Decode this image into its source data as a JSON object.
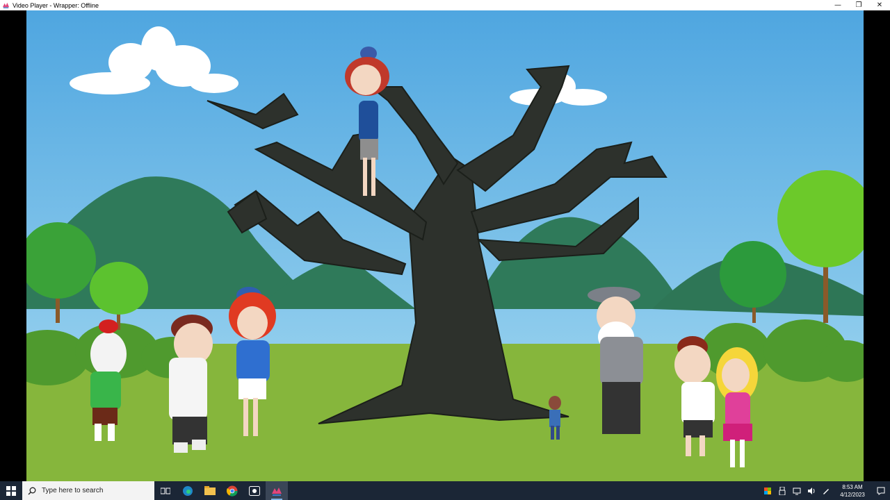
{
  "window": {
    "title": "Video Player - Wrapper: Offline",
    "app_icon": "wrapper-app-icon",
    "controls": {
      "minimize": "—",
      "restore": "❐",
      "close": "✕"
    }
  },
  "scene": {
    "description_icons": [
      "tree",
      "mountains",
      "clouds",
      "bushes",
      "characters"
    ]
  },
  "taskbar": {
    "search_placeholder": "Type here to search",
    "pinned": [
      "task-view-icon",
      "edge-icon",
      "file-explorer-icon",
      "chrome-icon",
      "screen-capture-icon",
      "wrapper-icon"
    ],
    "clock_time": "8:53 AM",
    "clock_date": "4/12/2023"
  },
  "colors": {
    "sky": "#5fb3e6",
    "grass": "#86b63c",
    "mountain": "#2f7a5a",
    "taskbar": "#1b2636"
  }
}
